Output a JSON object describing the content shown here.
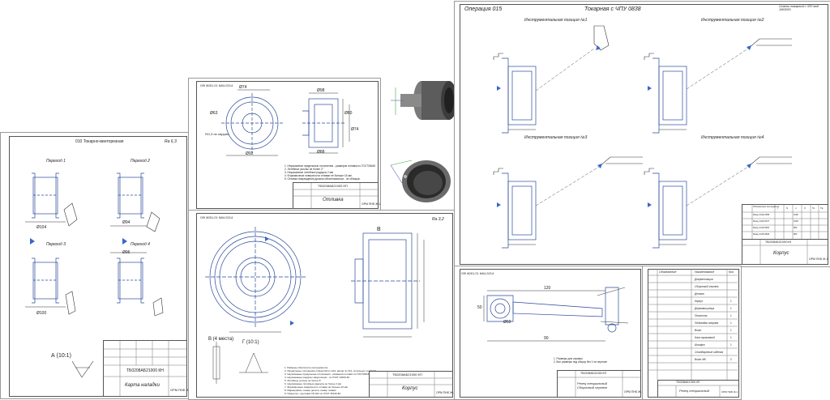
{
  "sheet_karta_naladki": {
    "header": "010 Токарно-винторезная",
    "corner_mark": "Ra 6,3",
    "positions": [
      "Переход 1",
      "Переход 2",
      "Переход 3",
      "Переход 4"
    ],
    "dim_labels": [
      "Ø104",
      "Ø94",
      "Ø100",
      "Ø96"
    ],
    "section_label": "А (10:1)",
    "stamp_code": "ТБ0208АБ21000 КН",
    "stamp_title": "Карта наладки",
    "stamp_org": "ОРМ ПНБ Ж-1"
  },
  "sheet_otlivka": {
    "rotated_code": "ОФ 8001.21 КАЧ.0214",
    "dims": [
      "Ø74",
      "Ø92",
      "Ø98",
      "Ø88",
      "Ø80",
      "Ø74",
      "Ø63"
    ],
    "note_side": "RО,5 по наружи",
    "notes": [
      "1. Неуказанные предельные отклонения - размеров отливки по ГОСТ26645",
      "2. Литейные уклоны не более 2°",
      "3. Неуказанные литейные радиусы 2 мм",
      "4. Формовочные поверхности отливки не больше 16 мм",
      "5. Отливка повреждения должна обеспечиваться - не облицов."
    ],
    "stamp_code": "ТБ0208АБ21000 КП",
    "stamp_title": "Отливка",
    "stamp_org": "ОРМ ПНБ Ж-1"
  },
  "sheet_korpus": {
    "rotated_code": "ОФ 8001.21 КАЧ.0214",
    "roughness": "Ra 3,2",
    "section_B": "В",
    "view_labels": [
      "В (4 места)",
      "Г (10:1)"
    ],
    "notes": [
      "1. Размеры обеспечить инструментом",
      "2. Предельные отклонения отверстий по H14, валов по h14, остальных по IT14/2",
      "3. Неуказанные предельные отклонения - размеров отливки по ГОСТ26645",
      "4. Неуказанные радиусы закругления - по ГОСТ 24643-81",
      "5. Литейные уклоны не более 2°",
      "6. Неуказанные литейные радиусы не более 2 мм",
      "7. Формовочные поверхности отливки не больше 16 мм",
      "8. Маркировать: номер детали, номер плавки",
      "9. Покрытие: грунтовка ГФ-021 по ГОСТ 25129-82"
    ],
    "stamp_code": "ТБ0208АБ21000 КП",
    "stamp_title": "Корпус",
    "stamp_org": "ОРМ ПНБ Ж-1"
  },
  "sheet_tokarnaya": {
    "operation": "Операция 015",
    "title": "Токарная с ЧПУ 0838",
    "corner": "Станок токарный с ЧПУ мод. 16К30Ф3",
    "positions": [
      "Инструментальная позиция №1",
      "Инструментальная позиция №2",
      "Инструментальная позиция №3",
      "Инструментальная позиция №4"
    ],
    "table_header": [
      "Обозначение инструмента",
      "t",
      "S",
      "n",
      "V",
      "То",
      "Тв"
    ],
    "table_rows": [
      [
        "Резец 2102-0055",
        "0,5",
        "0,15",
        "1000",
        "314",
        "0,3",
        "0,1"
      ],
      [
        "Резец 2103-0077",
        "0,5",
        "0,15",
        "1000",
        "314",
        "0,4",
        "0,1"
      ],
      [
        "Резец 2140-0001",
        "0,5",
        "0,10",
        "800",
        "251",
        "0,3",
        "0,1"
      ],
      [
        "Резец 2145-0502",
        "0,5",
        "0,10",
        "800",
        "251",
        "0,3",
        "0,1"
      ]
    ],
    "stamp_code": "ТБ0208АБ21000 КН",
    "stamp_title": "Корпус",
    "stamp_org": "ОРМ ПНБ Ж-1"
  },
  "sheet_fixture": {
    "rotated_code": "ОФ 8001.21 КАЧ.0214",
    "notes": [
      "1. Размеры для справок",
      "2. Все размеры под сборку без 1 на чертеже"
    ],
    "dims": [
      "120",
      "50",
      "90",
      "Ø60"
    ],
    "stamp_code": "ТБ0208АБ21000 КП",
    "stamp_title": "Резец специальный Сборочный чертеж",
    "stamp_org": "ОРМ ПНБ Ж-1"
  },
  "sheet_spec": {
    "header": [
      "Обозначение",
      "Наименование",
      "Кол."
    ],
    "rows": [
      [
        "",
        "Документация",
        ""
      ],
      [
        "",
        "Сборочный чертеж",
        ""
      ],
      [
        "",
        "Детали",
        ""
      ],
      [
        "",
        "Корпус",
        "1"
      ],
      [
        "",
        "Державка резца",
        "1"
      ],
      [
        "",
        "Пластина",
        "1"
      ],
      [
        "",
        "Подкладка опорная",
        "1"
      ],
      [
        "",
        "Винт",
        "1"
      ],
      [
        "",
        "Клин прижимной",
        "1"
      ],
      [
        "",
        "Штифт",
        "1"
      ],
      [
        "",
        "Стандартные изделия",
        ""
      ],
      [
        "",
        "Винт М6",
        "2"
      ]
    ],
    "stamp_code": "ТБ0208АБ21000 КП",
    "stamp_title": "Резец специальный",
    "stamp_org": "ОРМ ПНБ Ж-1"
  }
}
